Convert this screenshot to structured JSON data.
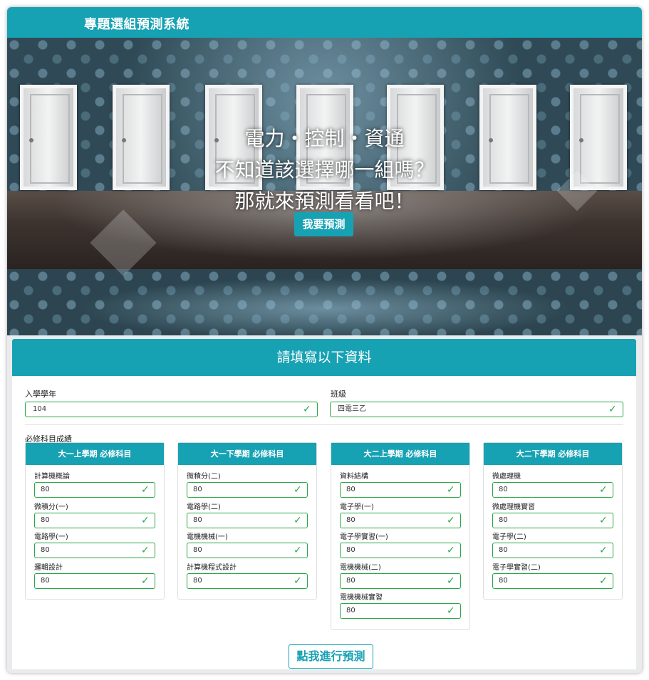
{
  "brand": "專題選組預測系統",
  "hero": {
    "line1": "電力・控制・資通",
    "line2": "不知道該選擇哪一組嗎？",
    "line3": "那就來預測看看吧！",
    "cta": "我要預測"
  },
  "form": {
    "title": "請填寫以下資料",
    "year": {
      "label": "入學學年",
      "value": "104"
    },
    "class": {
      "label": "班級",
      "value": "四電三乙"
    },
    "required_label": "必修科目成績",
    "semesters": [
      {
        "title": "大一上學期 必修科目",
        "courses": [
          {
            "name": "計算機概論",
            "score": "80"
          },
          {
            "name": "微積分(一)",
            "score": "80"
          },
          {
            "name": "電路學(一)",
            "score": "80"
          },
          {
            "name": "邏輯設計",
            "score": "80"
          }
        ]
      },
      {
        "title": "大一下學期 必修科目",
        "courses": [
          {
            "name": "微積分(二)",
            "score": "80"
          },
          {
            "name": "電路學(二)",
            "score": "80"
          },
          {
            "name": "電機機械(一)",
            "score": "80"
          },
          {
            "name": "計算機程式設計",
            "score": "80"
          }
        ]
      },
      {
        "title": "大二上學期 必修科目",
        "courses": [
          {
            "name": "資料結構",
            "score": "80"
          },
          {
            "name": "電子學(一)",
            "score": "80"
          },
          {
            "name": "電子學實習(一)",
            "score": "80"
          },
          {
            "name": "電機機械(二)",
            "score": "80"
          },
          {
            "name": "電機機械實習",
            "score": "80"
          }
        ]
      },
      {
        "title": "大二下學期 必修科目",
        "courses": [
          {
            "name": "微處理機",
            "score": "80"
          },
          {
            "name": "微處理機實習",
            "score": "80"
          },
          {
            "name": "電子學(二)",
            "score": "80"
          },
          {
            "name": "電子學實習(二)",
            "score": "80"
          }
        ]
      }
    ],
    "submit": "點我進行預測"
  },
  "colors": {
    "accent": "#17a2b4",
    "valid": "#28a745"
  },
  "icons": {
    "valid": "check-icon"
  }
}
